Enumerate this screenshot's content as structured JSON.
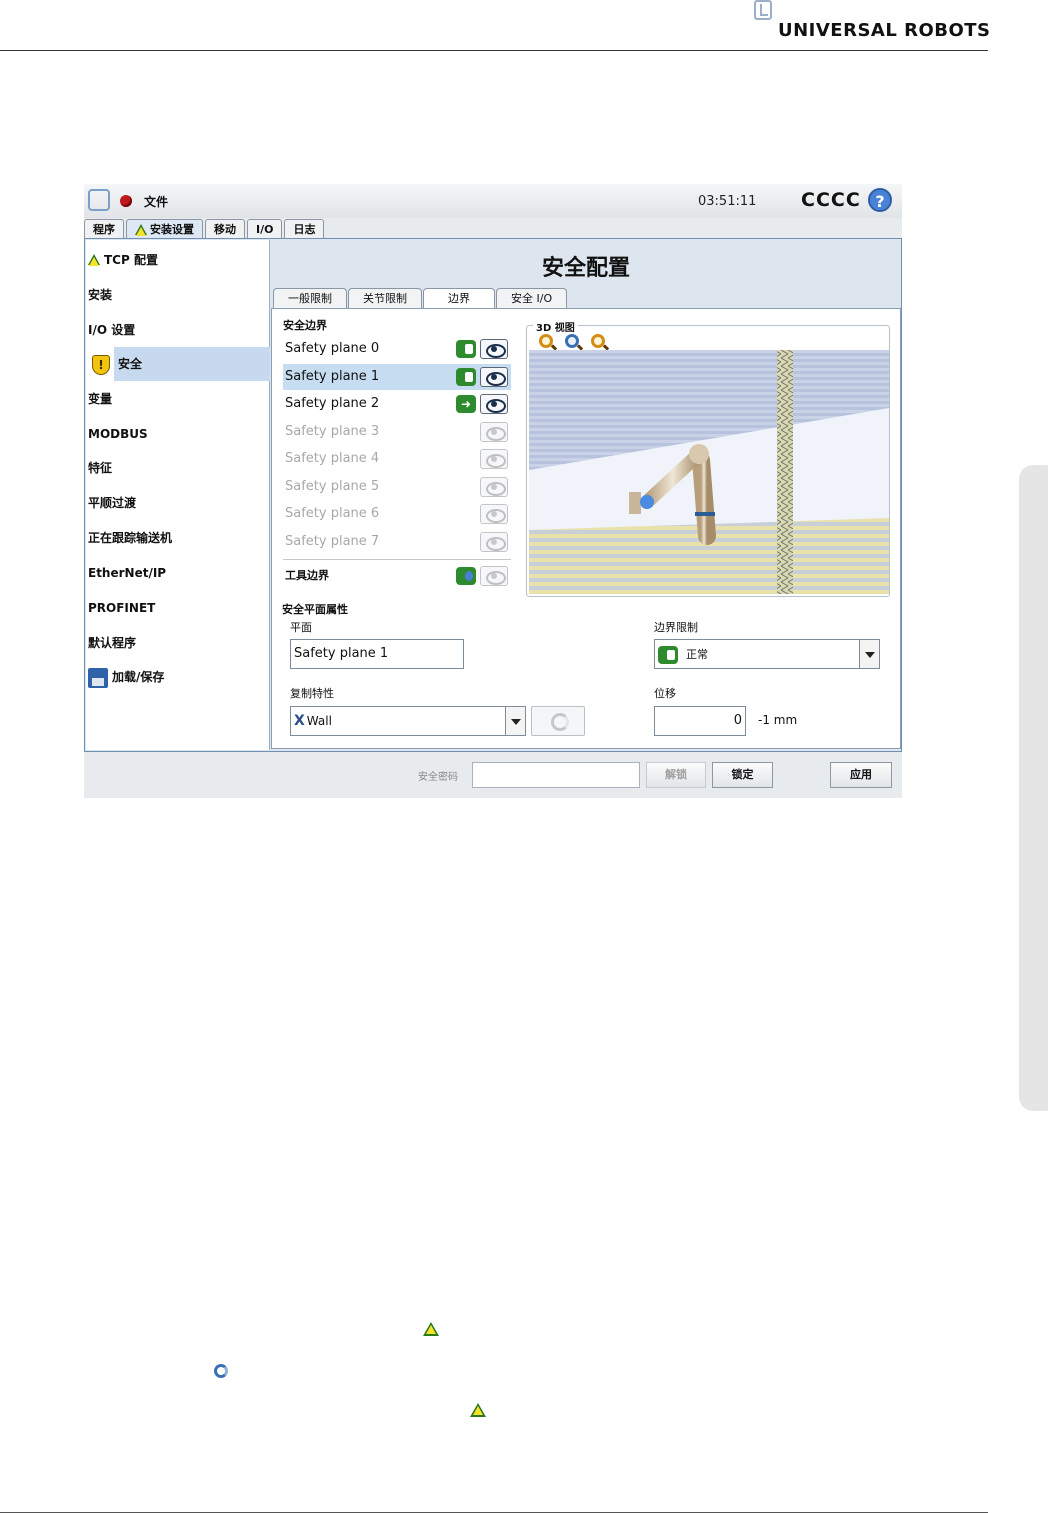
{
  "doc": {
    "brand": "UNIVERSAL ROBOTS"
  },
  "app": {
    "file_label": "文件",
    "clock": "03:51:11",
    "robot_name": "CCCC",
    "help_label": "?"
  },
  "main_tabs": [
    "程序",
    "安装设置",
    "移动",
    "I/O",
    "日志"
  ],
  "sidebar": {
    "items": [
      {
        "label": "TCP 配置"
      },
      {
        "label": "安装"
      },
      {
        "label": "I/O 设置"
      },
      {
        "label": "安全"
      },
      {
        "label": "变量"
      },
      {
        "label": "MODBUS"
      },
      {
        "label": "特征"
      },
      {
        "label": "平顺过渡"
      },
      {
        "label": "正在跟踪输送机"
      },
      {
        "label": "EtherNet/IP"
      },
      {
        "label": "PROFINET"
      },
      {
        "label": "默认程序"
      },
      {
        "label": "加载/保存"
      }
    ],
    "selected": "安全"
  },
  "page": {
    "title": "安全配置",
    "sub_tabs": [
      "一般限制",
      "关节限制",
      "边界",
      "安全 I/O"
    ],
    "active_sub_tab": "边界"
  },
  "boundaries": {
    "section_title": "安全边界",
    "planes": [
      {
        "label": "Safety plane 0",
        "mode": "normal",
        "visible": true,
        "enabled": true
      },
      {
        "label": "Safety plane 1",
        "mode": "normal",
        "visible": true,
        "enabled": true
      },
      {
        "label": "Safety plane 2",
        "mode": "trigger",
        "visible": true,
        "enabled": true
      },
      {
        "label": "Safety plane 3",
        "mode": "none",
        "visible": false,
        "enabled": false
      },
      {
        "label": "Safety plane 4",
        "mode": "none",
        "visible": false,
        "enabled": false
      },
      {
        "label": "Safety plane 5",
        "mode": "none",
        "visible": false,
        "enabled": false
      },
      {
        "label": "Safety plane 6",
        "mode": "none",
        "visible": false,
        "enabled": false
      },
      {
        "label": "Safety plane 7",
        "mode": "none",
        "visible": false,
        "enabled": false
      }
    ],
    "selected_plane": "Safety plane 1",
    "tool_boundary_label": "工具边界"
  },
  "view3d": {
    "label": "3D 视图",
    "zoom_icons": [
      "zoom-in-icon",
      "zoom-fit-icon",
      "zoom-out-icon"
    ]
  },
  "properties": {
    "section_title": "安全平面属性",
    "plane_label": "平面",
    "plane_name": "Safety plane 1",
    "copy_label": "复制特性",
    "copy_value": "Wall",
    "boundary_limit_label": "边界限制",
    "boundary_limit_value": "正常",
    "offset_label": "位移",
    "offset_value": "0",
    "offset_unit": "-1 mm"
  },
  "footer_bar": {
    "password_label": "安全密码",
    "unlock_label": "解锁",
    "lock_label": "锁定",
    "apply_label": "应用"
  },
  "colors": {
    "accent": "#4a82d6",
    "selection": "#c6dcf0",
    "toggle_on": "#2d8a2d",
    "warning": "#f4e32a",
    "record": "#c0181c"
  }
}
